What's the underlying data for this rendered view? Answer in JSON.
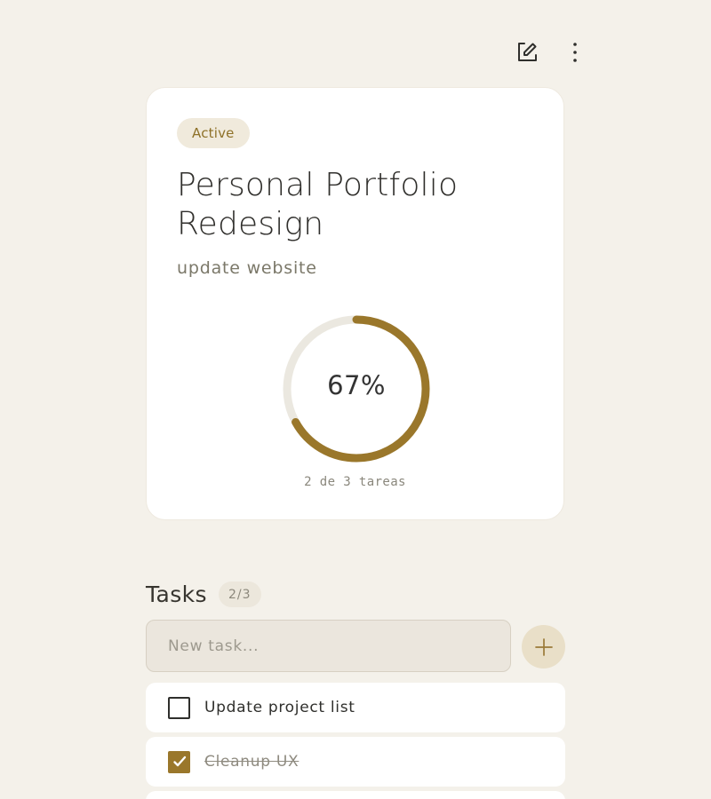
{
  "toolbar": {
    "edit_icon": "edit-icon",
    "more_icon": "more-vertical-icon"
  },
  "project": {
    "status": "Active",
    "title": "Personal Portfolio Redesign",
    "subtitle": "update website",
    "progress": {
      "percent_label": "67%",
      "fraction": 0.67,
      "caption": "2 de 3 tareas"
    }
  },
  "tasks": {
    "title": "Tasks",
    "count": "2/3",
    "input_placeholder": "New task...",
    "add_icon": "plus-icon",
    "items": [
      {
        "label": "Update project list",
        "completed": false
      },
      {
        "label": "Cleanup UX",
        "completed": true
      }
    ]
  },
  "colors": {
    "background": "#f4f1ea",
    "accent": "#9a772b",
    "badge_background": "#f0eadc",
    "progress_track": "#ebe8e0"
  }
}
